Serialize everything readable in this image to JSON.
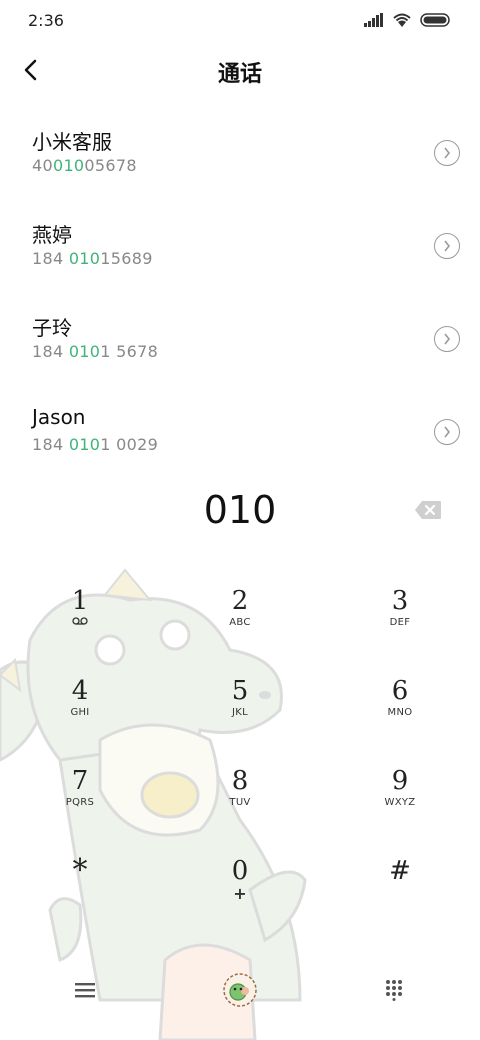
{
  "status": {
    "time": "2:36"
  },
  "header": {
    "title": "通话"
  },
  "contacts": [
    {
      "name": "小米客服",
      "number_pre": "40",
      "number_hl": "010",
      "number_post": "05678"
    },
    {
      "name": "燕婷",
      "number_pre": "184 ",
      "number_hl": "010",
      "number_post": "15689"
    },
    {
      "name": "子玲",
      "number_pre": "184 ",
      "number_hl": "010",
      "number_post": "1 5678"
    },
    {
      "name": "Jason",
      "number_pre": "184 ",
      "number_hl": "010",
      "number_post": "1 0029"
    }
  ],
  "dial": {
    "number": "010"
  },
  "keypad": {
    "k1": {
      "digit": "1",
      "sub": "voicemail"
    },
    "k2": {
      "digit": "2",
      "letters": "ABC"
    },
    "k3": {
      "digit": "3",
      "letters": "DEF"
    },
    "k4": {
      "digit": "4",
      "letters": "GHI"
    },
    "k5": {
      "digit": "5",
      "letters": "JKL"
    },
    "k6": {
      "digit": "6",
      "letters": "MNO"
    },
    "k7": {
      "digit": "7",
      "letters": "PQRS"
    },
    "k8": {
      "digit": "8",
      "letters": "TUV"
    },
    "k9": {
      "digit": "9",
      "letters": "WXYZ"
    },
    "kstar": {
      "digit": "*"
    },
    "k0": {
      "digit": "0",
      "letters": "+"
    },
    "khash": {
      "digit": "#"
    }
  },
  "bottom_nav": {
    "left_icon": "menu-icon",
    "center_icon": "dinosaur-avatar-icon",
    "right_icon": "keypad-icon"
  },
  "colors": {
    "highlight": "#3fb47a",
    "illustration": "#e9efe6"
  }
}
